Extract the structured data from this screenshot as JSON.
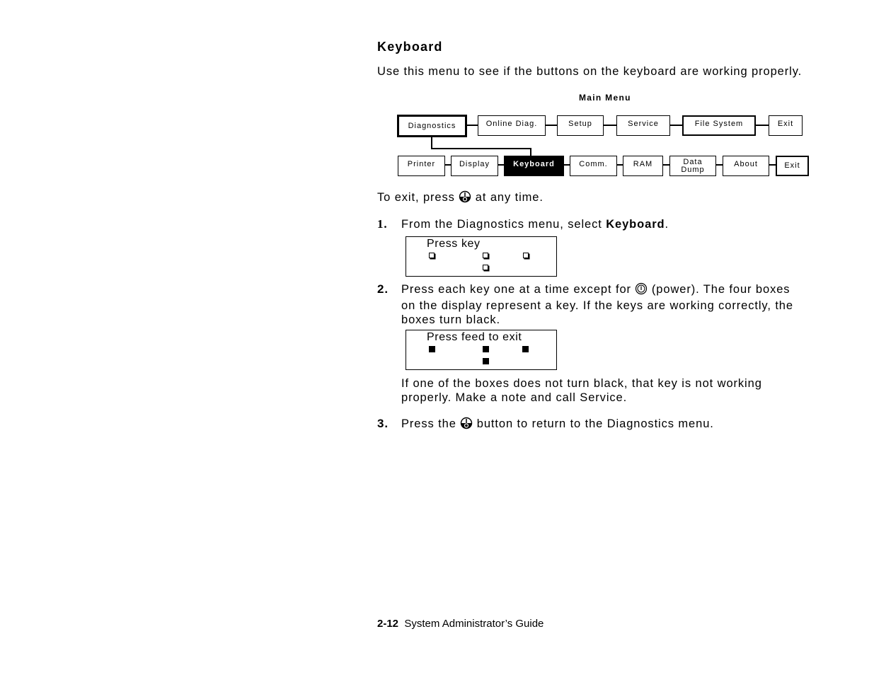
{
  "section": {
    "title": "Keyboard",
    "intro": "Use this menu to see if the buttons on the keyboard are working properly."
  },
  "menu_diagram": {
    "title": "Main Menu",
    "main_items": [
      {
        "label": "Diagnostics",
        "state": "current-path"
      },
      {
        "label": "Online Diag."
      },
      {
        "label": "Setup"
      },
      {
        "label": "Service"
      },
      {
        "label": "File System"
      },
      {
        "label": "Exit"
      }
    ],
    "sub_items": [
      {
        "label": "Printer"
      },
      {
        "label": "Display"
      },
      {
        "label": "Keyboard",
        "state": "selected"
      },
      {
        "label": "Comm."
      },
      {
        "label": "RAM"
      },
      {
        "label": "Data Dump",
        "line1": "Data",
        "line2": "Dump"
      },
      {
        "label": "About"
      },
      {
        "label": "Exit"
      }
    ]
  },
  "exit_note": {
    "before": "To exit, press",
    "icon": "escape-key-icon",
    "after": "at any time."
  },
  "steps": [
    {
      "number": "1.",
      "text_before": "From the Diagnostics menu, select",
      "bold": "Keyboard",
      "text_after": ".",
      "display": {
        "text": "Press key",
        "boxes": [
          "empty",
          "empty",
          "empty",
          "empty"
        ]
      }
    },
    {
      "number": "2.",
      "line1_before": "Press each key one at a time except for",
      "icon": "power-icon",
      "line1_after": "(power).  The four boxes",
      "line2": "on the display represent a key.  If the keys are working correctly, the",
      "line3": "boxes turn black.",
      "display": {
        "text": "Press feed to exit",
        "boxes": [
          "filled",
          "filled",
          "filled",
          "filled"
        ]
      },
      "note_line1": "If one of the boxes does not turn black, that key is not working",
      "note_line2": "properly.  Make a note and call Service."
    },
    {
      "number": "3.",
      "text_before": "Press the",
      "icon": "escape-key-icon",
      "text_after": "button to return to the Diagnostics menu."
    }
  ],
  "footer": {
    "page": "2-12",
    "title": "System Administrator’s Guide"
  }
}
